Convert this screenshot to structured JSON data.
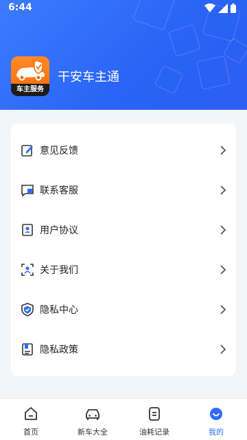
{
  "status_bar": {
    "time": "6:44"
  },
  "header": {
    "app_name": "干安车主通",
    "logo_text": "车主服务"
  },
  "menu": [
    {
      "label": "意见反馈",
      "icon": "feedback-icon"
    },
    {
      "label": "联系客服",
      "icon": "customer-service-icon"
    },
    {
      "label": "用户协议",
      "icon": "user-agreement-icon"
    },
    {
      "label": "关于我们",
      "icon": "about-icon"
    },
    {
      "label": "隐私中心",
      "icon": "privacy-center-shield-icon"
    },
    {
      "label": "隐私政策",
      "icon": "privacy-policy-icon"
    }
  ],
  "tabs": [
    {
      "label": "首页",
      "icon": "home-icon",
      "active": false
    },
    {
      "label": "新车大全",
      "icon": "car-icon",
      "active": false
    },
    {
      "label": "油耗记录",
      "icon": "fuel-record-icon",
      "active": false
    },
    {
      "label": "我的",
      "icon": "profile-icon",
      "active": true
    }
  ],
  "colors": {
    "primary": "#2f6bff",
    "header": "#2a63f5",
    "logo": "#ff7a12"
  }
}
